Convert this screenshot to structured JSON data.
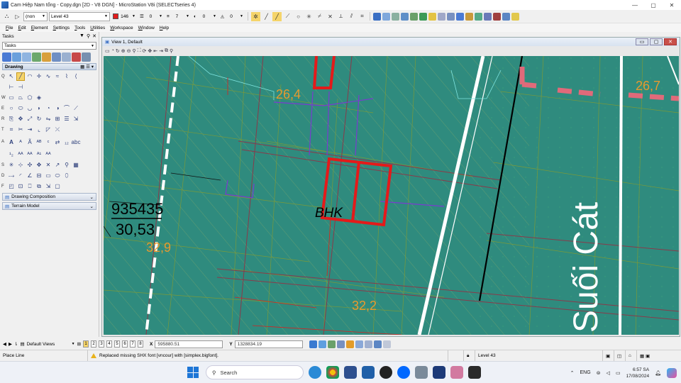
{
  "window": {
    "title": "Cam Hiệp Nam tổng - Copy.dgn [2D - V8 DGN] - MicroStation V8i (SELECTseries 4)",
    "controls": [
      "—",
      "▢",
      "✕"
    ]
  },
  "attributes": {
    "element_template": "(non",
    "level": "Level 43",
    "color": "146",
    "color_hex": "#e31b1b",
    "line_style": "0",
    "line_weight": "7",
    "transparency": "0",
    "priority": "0"
  },
  "menu": [
    "File",
    "Edit",
    "Element",
    "Settings",
    "Tools",
    "Utilities",
    "Workspace",
    "Window",
    "Help"
  ],
  "tasks": {
    "title": "Tasks",
    "combo": "Tasks",
    "section": "Drawing",
    "row_keys": [
      "Q",
      "W",
      "E",
      "R",
      "T",
      "A",
      "S",
      "D",
      "F"
    ],
    "collapsed": [
      "Drawing Composition",
      "Terrain Model"
    ]
  },
  "view": {
    "title": "View 1, Default",
    "map_labels": {
      "parcel_number": "935435",
      "parcel_area": "30,53",
      "elev_1": "26,4",
      "elev_2": "26,7",
      "elev_3": "32,9",
      "elev_4": "32,2",
      "zone": "BHK",
      "river": "Suối Cát"
    },
    "colors": {
      "ground": "#2f8b7e",
      "parcel_border": "#e41a1a",
      "road": "#ffffff",
      "elev_text": "#e79a2e",
      "lines": "#7a9a3a",
      "purple": "#7a3bd0",
      "pink": "#e06a7a"
    }
  },
  "viewbar": {
    "views_label": "Default Views",
    "view_numbers": [
      "1",
      "2",
      "3",
      "4",
      "5",
      "6",
      "7",
      "8"
    ],
    "x_label": "X",
    "x_value": "595880.51",
    "y_label": "Y",
    "y_value": "1328834.19"
  },
  "status": {
    "prompt": "Place Line",
    "message": "Replaced missing SHX font [vncour] with [simplex.bigfont].",
    "level": "Level 43"
  },
  "taskbar": {
    "search": "Search",
    "lang": "ENG",
    "time": "6:57 SA",
    "date": "17/08/2024"
  }
}
